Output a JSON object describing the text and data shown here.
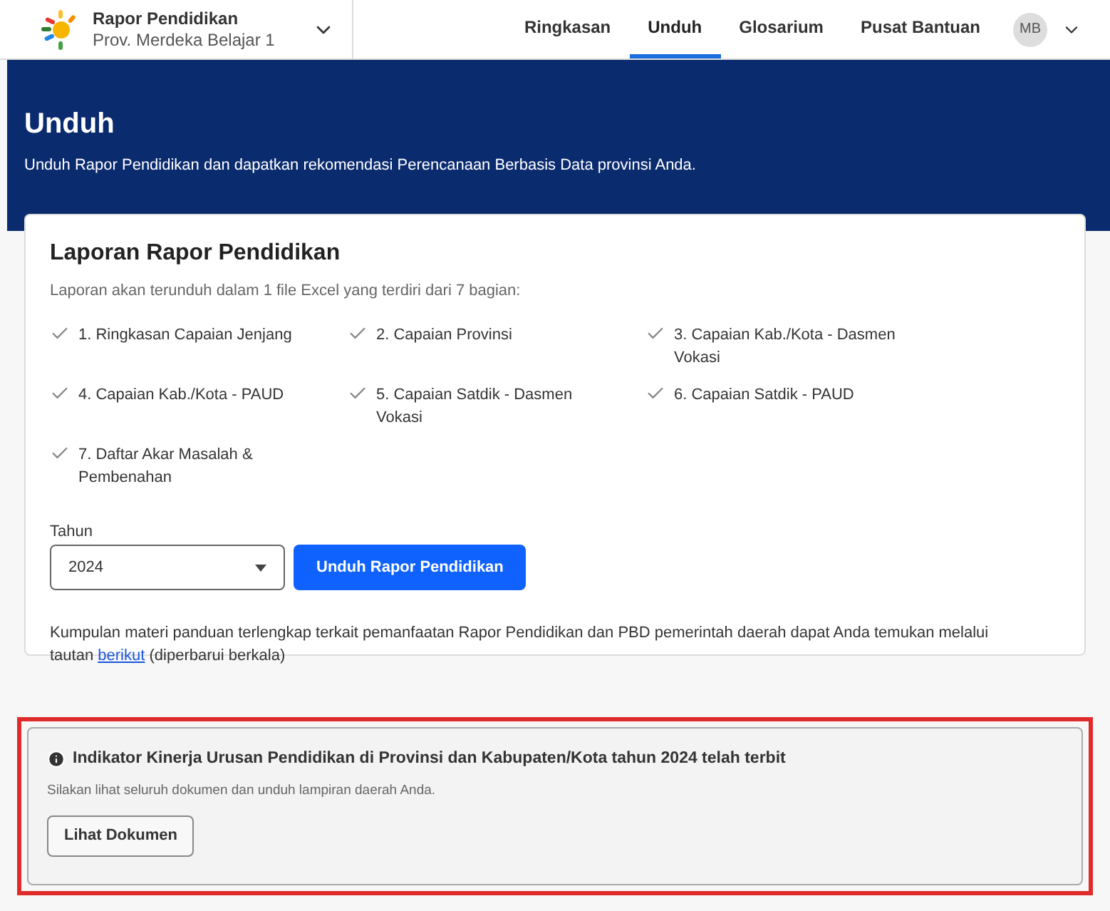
{
  "header": {
    "app_name": "Rapor Pendidikan",
    "region": "Prov. Merdeka Belajar 1",
    "nav": [
      {
        "label": "Ringkasan",
        "selected": false
      },
      {
        "label": "Unduh",
        "selected": true
      },
      {
        "label": "Glosarium",
        "selected": false
      },
      {
        "label": "Pusat Bantuan",
        "selected": false
      }
    ],
    "avatar": "MB"
  },
  "banner": {
    "title": "Unduh",
    "subtitle": "Unduh Rapor Pendidikan dan dapatkan rekomendasi Perencanaan Berbasis Data provinsi Anda."
  },
  "report_card": {
    "title": "Laporan Rapor Pendidikan",
    "description": "Laporan akan terunduh dalam 1 file Excel yang terdiri dari 7 bagian:",
    "sections": [
      "1. Ringkasan Capaian Jenjang",
      "2. Capaian Provinsi",
      "3. Capaian Kab./Kota - Dasmen Vokasi",
      "4. Capaian Kab./Kota - PAUD",
      "5. Capaian Satdik - Dasmen Vokasi",
      "6. Capaian Satdik - PAUD",
      "7. Daftar Akar Masalah & Pembenahan"
    ],
    "year_label": "Tahun",
    "year_value": "2024",
    "download_button": "Unduh Rapor Pendidikan",
    "note_before": "Kumpulan materi panduan terlengkap terkait pemanfaatan Rapor Pendidikan dan PBD pemerintah daerah dapat Anda temukan melalui tautan ",
    "note_link": "berikut",
    "note_after": " (diperbarui berkala)"
  },
  "notice": {
    "title": "Indikator Kinerja Urusan Pendidikan di Provinsi dan Kabupaten/Kota tahun 2024 telah terbit",
    "text": "Silakan lihat seluruh dokumen dan unduh lampiran daerah Anda.",
    "button": "Lihat Dokumen"
  }
}
